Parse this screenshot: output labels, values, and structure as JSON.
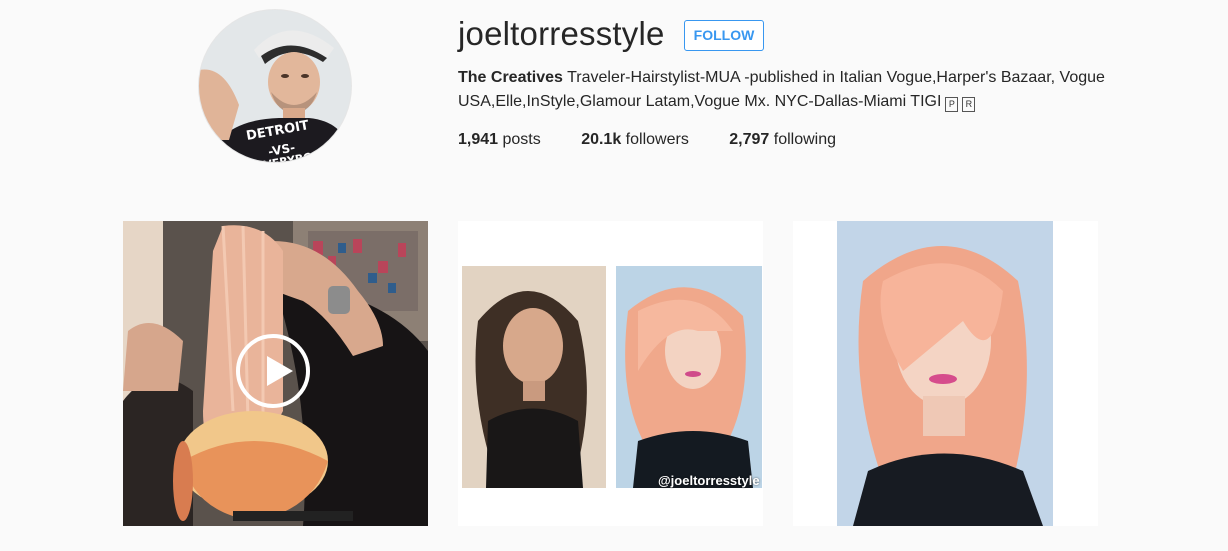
{
  "profile": {
    "username": "joeltorresstyle",
    "follow_label": "FOLLOW",
    "bio_name": "The Creatives",
    "bio_text": " Traveler-Hairstylist-MUA -published in Italian Vogue,Harper's Bazaar, Vogue USA,Elle,InStyle,Glamour Latam,Vogue Mx. NYC-Dallas-Miami TIGI",
    "bio_glyphs": [
      "P",
      "R"
    ],
    "shirt_text": [
      "DETROIT",
      "-VS-",
      "EVERYBODY"
    ]
  },
  "stats": {
    "posts_count": "1,941",
    "posts_label": " posts",
    "followers_count": "20.1k",
    "followers_label": " followers",
    "following_count": "2,797",
    "following_label": " following"
  },
  "posts": {
    "watermark": "@joeltorresstyle"
  },
  "icons": {
    "play": "play-icon"
  },
  "colors": {
    "accent": "#3897f0",
    "background": "#fafafa",
    "text": "#262626"
  }
}
